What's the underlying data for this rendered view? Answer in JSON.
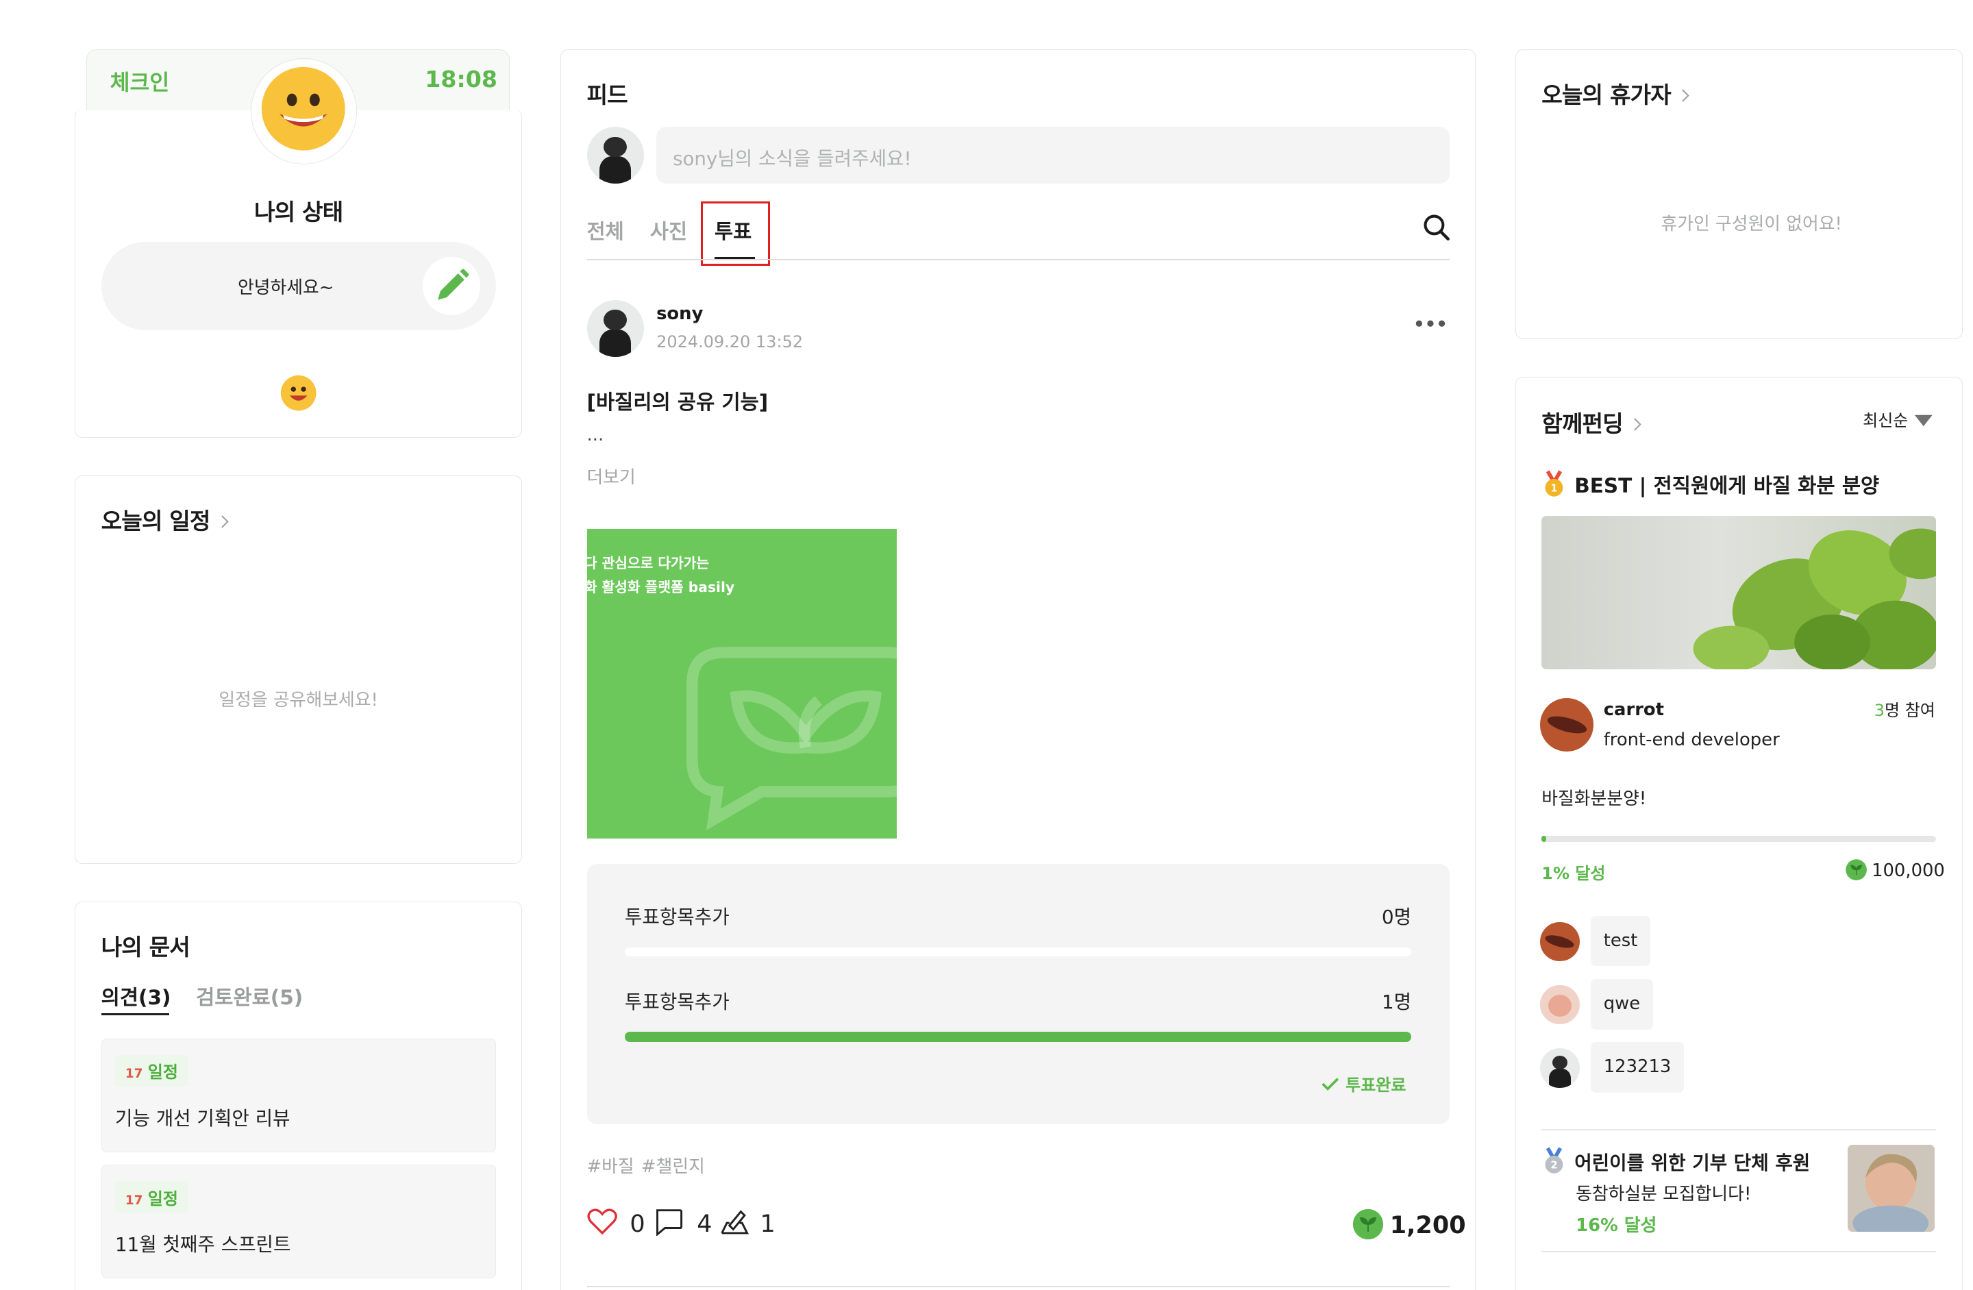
{
  "colors": {
    "accent": "#5cb84c",
    "vote_highlight": "#e02020",
    "image_green": "#6cc85a"
  },
  "checkin": {
    "label": "체크인",
    "time": "18:08",
    "status_title": "나의 상태",
    "status_message": "안녕하세요~"
  },
  "schedule": {
    "title": "오늘의 일정",
    "empty": "일정을 공유해보세요!"
  },
  "documents": {
    "title": "나의 문서",
    "tabs": [
      {
        "label": "의견(3)",
        "active": true
      },
      {
        "label": "검토완료(5)",
        "active": false
      }
    ],
    "items": [
      {
        "tag": "일정",
        "tag_icon": "calendar-17-icon",
        "title": "기능 개선 기획안 리뷰"
      },
      {
        "tag": "일정",
        "tag_icon": "calendar-17-icon",
        "title": "11월 첫째주 스프린트"
      }
    ]
  },
  "feed": {
    "title": "피드",
    "composer_placeholder": "sony님의 소식을 들려주세요!",
    "tabs": [
      {
        "label": "전체"
      },
      {
        "label": "사진"
      },
      {
        "label": "투표",
        "active": true
      }
    ],
    "post": {
      "author": "sony",
      "date": "2024.09.20 13:52",
      "title": "[바질리의 공유 기능]",
      "excerpt": "...",
      "more": "더보기",
      "image_text_line1": "다 관심으로 다가가는",
      "image_text_line2": "화 활성화 플랫폼 basily",
      "poll": {
        "options": [
          {
            "label": "투표항목추가",
            "count": "0명",
            "fraction": 0.0
          },
          {
            "label": "투표항목추가",
            "count": "1명",
            "fraction": 1.0
          }
        ],
        "done_label": "투표완료"
      },
      "hashtags": [
        "#바질",
        "#챌린지"
      ],
      "likes": "0",
      "comments": "4",
      "shares": "1",
      "points": "1,200"
    }
  },
  "vacation": {
    "title": "오늘의 휴가자",
    "empty": "휴가인 구성원이 없어요!"
  },
  "funding": {
    "title": "함께펀딩",
    "sort": "최신순",
    "best": {
      "badge": "BEST",
      "name": "전직원에게 바질 화분 분양",
      "author": "carrot",
      "role": "front-end developer",
      "participants_num": "3",
      "participants_suffix": "명 참여",
      "description": "바질화분분양!",
      "progress_label": "1% 달성",
      "progress_fraction": 0.01,
      "goal": "100,000",
      "members": [
        "test",
        "qwe",
        "123213"
      ]
    },
    "second": {
      "title": "어린이를 위한 기부 단체 후원",
      "subtitle": "동참하실분 모집합니다!",
      "progress_label": "16% 달성"
    }
  }
}
